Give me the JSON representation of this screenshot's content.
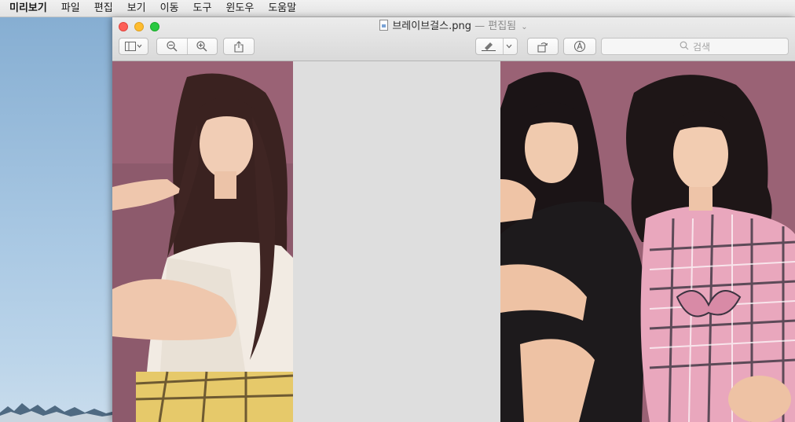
{
  "menubar": {
    "items": [
      "미리보기",
      "파일",
      "편집",
      "보기",
      "이동",
      "도구",
      "윈도우",
      "도움말"
    ]
  },
  "window": {
    "title": "브레이브걸스.png",
    "status": "— 편집됨",
    "toolbar": {
      "search_placeholder": "검색"
    }
  },
  "icons": {
    "sidebar": "sidebar-icon",
    "zoom_out": "zoom-out-icon",
    "zoom_in": "zoom-in-icon",
    "share": "share-icon",
    "highlight": "highlighter-icon",
    "rotate": "rotate-icon",
    "markup": "markup-icon",
    "search": "search-icon"
  },
  "colors": {
    "photo_background": "#9a6275",
    "canvas_gap": "#dedede",
    "traffic_close": "#fd5f57",
    "traffic_min": "#febc2e",
    "traffic_max": "#28c840"
  }
}
